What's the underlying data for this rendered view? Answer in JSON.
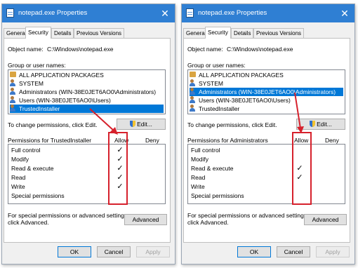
{
  "annotation_color": "#d6212c",
  "dialogs": [
    {
      "title": "notepad.exe Properties",
      "close_glyph": "✕",
      "tabs": [
        "General",
        "Security",
        "Details",
        "Previous Versions"
      ],
      "object_name_label": "Object name:",
      "object_name_value": "C:\\Windows\\notepad.exe",
      "group_label": "Group or user names:",
      "users": [
        {
          "name": "ALL APPLICATION PACKAGES",
          "icon": "package-icon"
        },
        {
          "name": "SYSTEM",
          "icon": "user-group-icon"
        },
        {
          "name": "Administrators (WIN-38E0JET6AO0\\Administrators)",
          "icon": "user-group-icon"
        },
        {
          "name": "Users (WIN-38E0JET6AO0\\Users)",
          "icon": "user-group-icon"
        },
        {
          "name": "TrustedInstaller",
          "icon": "user-icon",
          "selected": true
        }
      ],
      "change_label": "To change permissions, click Edit.",
      "edit_label": "Edit...",
      "permissions_for": "Permissions for TrustedInstaller",
      "allow_header": "Allow",
      "deny_header": "Deny",
      "permissions": [
        {
          "name": "Full control",
          "allow": "✓"
        },
        {
          "name": "Modify",
          "allow": "✓"
        },
        {
          "name": "Read & execute",
          "allow": "✓"
        },
        {
          "name": "Read",
          "allow": "✓"
        },
        {
          "name": "Write",
          "allow": "✓"
        },
        {
          "name": "Special permissions",
          "allow": ""
        }
      ],
      "special_line1": "For special permissions or advanced settings,",
      "special_line2": "click Advanced.",
      "advanced_label": "Advanced",
      "ok_label": "OK",
      "cancel_label": "Cancel",
      "apply_label": "Apply"
    },
    {
      "title": "notepad.exe Properties",
      "close_glyph": "✕",
      "tabs": [
        "General",
        "Security",
        "Details",
        "Previous Versions"
      ],
      "object_name_label": "Object name:",
      "object_name_value": "C:\\Windows\\notepad.exe",
      "group_label": "Group or user names:",
      "users": [
        {
          "name": "ALL APPLICATION PACKAGES",
          "icon": "package-icon"
        },
        {
          "name": "SYSTEM",
          "icon": "user-group-icon"
        },
        {
          "name": "Administrators (WIN-38E0JET6AO0\\Administrators)",
          "icon": "user-group-icon",
          "selected": true
        },
        {
          "name": "Users (WIN-38E0JET6AO0\\Users)",
          "icon": "user-group-icon"
        },
        {
          "name": "TrustedInstaller",
          "icon": "user-icon"
        }
      ],
      "change_label": "To change permissions, click Edit.",
      "edit_label": "Edit...",
      "permissions_for": "Permissions for Administrators",
      "allow_header": "Allow",
      "deny_header": "Deny",
      "permissions": [
        {
          "name": "Full control",
          "allow": ""
        },
        {
          "name": "Modify",
          "allow": ""
        },
        {
          "name": "Read & execute",
          "allow": "✓"
        },
        {
          "name": "Read",
          "allow": "✓"
        },
        {
          "name": "Write",
          "allow": ""
        },
        {
          "name": "Special permissions",
          "allow": ""
        }
      ],
      "special_line1": "For special permissions or advanced settings,",
      "special_line2": "click Advanced.",
      "advanced_label": "Advanced",
      "ok_label": "OK",
      "cancel_label": "Cancel",
      "apply_label": "Apply"
    }
  ]
}
